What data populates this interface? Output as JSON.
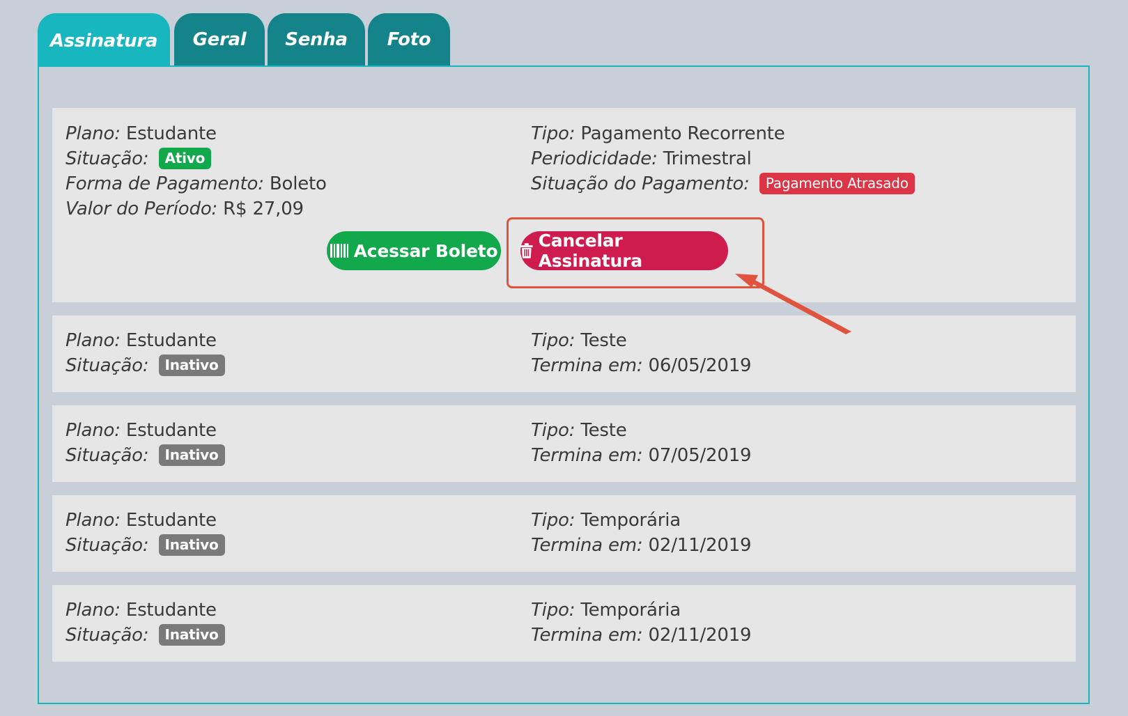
{
  "tabs": [
    {
      "label": "Assinatura",
      "active": true
    },
    {
      "label": "Geral",
      "active": false
    },
    {
      "label": "Senha",
      "active": false
    },
    {
      "label": "Foto",
      "active": false
    }
  ],
  "labels": {
    "plano": "Plano:",
    "situacao": "Situação:",
    "forma_pagamento": "Forma de Pagamento:",
    "valor_periodo": "Valor do Período:",
    "tipo": "Tipo:",
    "periodicidade": "Periodicidade:",
    "situacao_pagamento": "Situação do Pagamento:",
    "termina_em": "Termina em:"
  },
  "active_subscription": {
    "plano": "Estudante",
    "situacao": "Ativo",
    "forma_pagamento": "Boleto",
    "valor_periodo": "R$ 27,09",
    "tipo": "Pagamento Recorrente",
    "periodicidade": "Trimestral",
    "situacao_pagamento": "Pagamento Atrasado",
    "buttons": {
      "acessar_boleto": "Acessar Boleto",
      "cancelar_assinatura": "Cancelar Assinatura"
    }
  },
  "past_subscriptions": [
    {
      "plano": "Estudante",
      "situacao": "Inativo",
      "tipo": "Teste",
      "termina_em": "06/05/2019"
    },
    {
      "plano": "Estudante",
      "situacao": "Inativo",
      "tipo": "Teste",
      "termina_em": "07/05/2019"
    },
    {
      "plano": "Estudante",
      "situacao": "Inativo",
      "tipo": "Temporária",
      "termina_em": "02/11/2019"
    },
    {
      "plano": "Estudante",
      "situacao": "Inativo",
      "tipo": "Temporária",
      "termina_em": "02/11/2019"
    }
  ],
  "colors": {
    "tab_active": "#18b6bf",
    "tab_inactive": "#15838a",
    "success": "#12a84c",
    "danger": "#dc3545",
    "cancel_button": "#cf1c4f",
    "annotation": "#e0533f"
  }
}
